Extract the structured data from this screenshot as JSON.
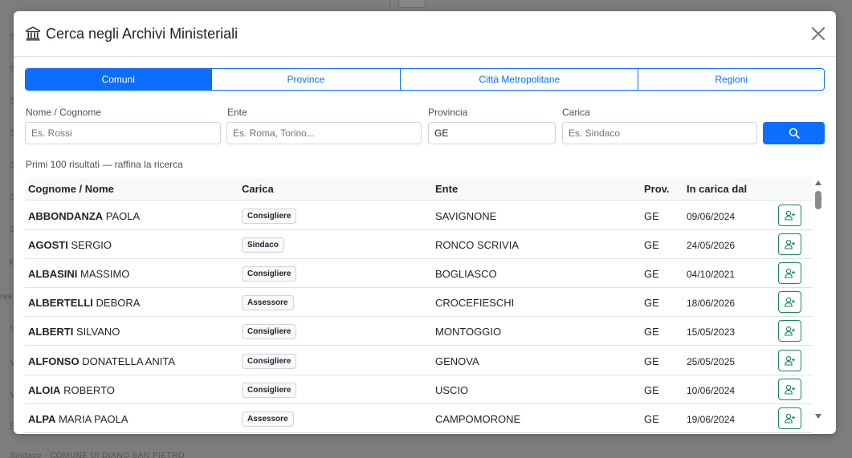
{
  "background": {
    "lines": [
      "S",
      "S",
      "S",
      "S",
      "S",
      "S",
      "S",
      "P",
      "res",
      "S",
      "V",
      "V",
      "S"
    ],
    "bottom_text": "Sindaco · COMUNE DI DIANO SAN PIETRO"
  },
  "modal": {
    "title": "Cerca negli Archivi Ministeriali",
    "title_icon": "bank-icon",
    "close_icon": "close-icon"
  },
  "tabs": [
    {
      "label": "Comuni",
      "active": true
    },
    {
      "label": "Province",
      "active": false
    },
    {
      "label": "Città Metropolitane",
      "active": false
    },
    {
      "label": "Regioni",
      "active": false
    }
  ],
  "filters": {
    "nome": {
      "label": "Nome / Cognome",
      "placeholder": "Es. Rossi",
      "value": ""
    },
    "ente": {
      "label": "Ente",
      "placeholder": "Es. Roma, Torino...",
      "value": ""
    },
    "provincia": {
      "label": "Provincia",
      "placeholder": "",
      "value": "GE"
    },
    "carica": {
      "label": "Carica",
      "placeholder": "Es. Sindaco",
      "value": ""
    },
    "search_icon": "search-icon"
  },
  "results_note": "Primi 100 risultati — raffina la ricerca",
  "table": {
    "headers": {
      "nome": "Cognome / Nome",
      "carica": "Carica",
      "ente": "Ente",
      "prov": "Prov.",
      "dal": "In carica dal"
    },
    "rows": [
      {
        "surname": "ABBONDANZA",
        "name": "PAOLA",
        "carica": "Consigliere",
        "ente": "SAVIGNONE",
        "prov": "GE",
        "dal": "09/06/2024"
      },
      {
        "surname": "AGOSTI",
        "name": "SERGIO",
        "carica": "Sindaco",
        "ente": "RONCO SCRIVIA",
        "prov": "GE",
        "dal": "24/05/2026"
      },
      {
        "surname": "ALBASINI",
        "name": "MASSIMO",
        "carica": "Consigliere",
        "ente": "BOGLIASCO",
        "prov": "GE",
        "dal": "04/10/2021"
      },
      {
        "surname": "ALBERTELLI",
        "name": "DEBORA",
        "carica": "Assessore",
        "ente": "CROCEFIESCHI",
        "prov": "GE",
        "dal": "18/06/2026"
      },
      {
        "surname": "ALBERTI",
        "name": "SILVANO",
        "carica": "Consigliere",
        "ente": "MONTOGGIO",
        "prov": "GE",
        "dal": "15/05/2023"
      },
      {
        "surname": "ALFONSO",
        "name": "DONATELLA ANITA",
        "carica": "Consigliere",
        "ente": "GENOVA",
        "prov": "GE",
        "dal": "25/05/2025"
      },
      {
        "surname": "ALOIA",
        "name": "ROBERTO",
        "carica": "Consigliere",
        "ente": "USCIO",
        "prov": "GE",
        "dal": "10/06/2024"
      },
      {
        "surname": "ALPA",
        "name": "MARIA PAOLA",
        "carica": "Assessore",
        "ente": "CAMPOMORONE",
        "prov": "GE",
        "dal": "19/06/2024"
      }
    ],
    "row_action_icon": "user-plus-icon"
  },
  "colors": {
    "primary": "#0d6efd",
    "success": "#198754"
  }
}
